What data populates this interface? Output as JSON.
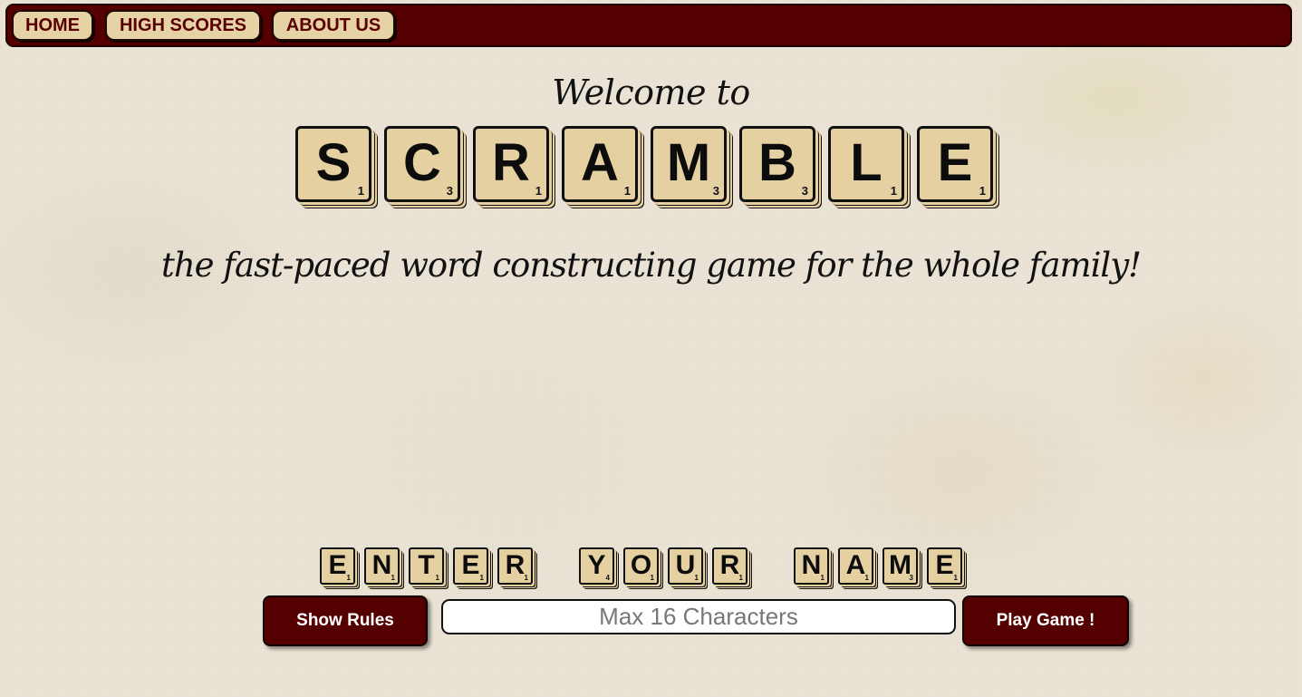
{
  "nav": {
    "items": [
      {
        "label": "HOME"
      },
      {
        "label": "HIGH SCORES"
      },
      {
        "label": "ABOUT US"
      }
    ]
  },
  "hero": {
    "welcome": "Welcome to",
    "title_tiles": [
      {
        "letter": "S",
        "points": "1"
      },
      {
        "letter": "C",
        "points": "3"
      },
      {
        "letter": "R",
        "points": "1"
      },
      {
        "letter": "A",
        "points": "1"
      },
      {
        "letter": "M",
        "points": "3"
      },
      {
        "letter": "B",
        "points": "3"
      },
      {
        "letter": "L",
        "points": "1"
      },
      {
        "letter": "E",
        "points": "1"
      }
    ],
    "tagline": "the fast-paced word constructing game for the whole family!"
  },
  "name_prompt": {
    "words": [
      [
        {
          "letter": "E",
          "points": "1"
        },
        {
          "letter": "N",
          "points": "1"
        },
        {
          "letter": "T",
          "points": "1"
        },
        {
          "letter": "E",
          "points": "1"
        },
        {
          "letter": "R",
          "points": "1"
        }
      ],
      [
        {
          "letter": "Y",
          "points": "4"
        },
        {
          "letter": "O",
          "points": "1"
        },
        {
          "letter": "U",
          "points": "1"
        },
        {
          "letter": "R",
          "points": "1"
        }
      ],
      [
        {
          "letter": "N",
          "points": "1"
        },
        {
          "letter": "A",
          "points": "1"
        },
        {
          "letter": "M",
          "points": "3"
        },
        {
          "letter": "E",
          "points": "1"
        }
      ]
    ]
  },
  "controls": {
    "show_rules_label": "Show Rules",
    "name_placeholder": "Max 16 Characters",
    "name_value": "",
    "play_label": "Play Game !"
  },
  "colors": {
    "nav_background": "#540000",
    "tile_face": "#e5d0a2",
    "button_background": "#540000",
    "nav_text": "#5a0000"
  }
}
